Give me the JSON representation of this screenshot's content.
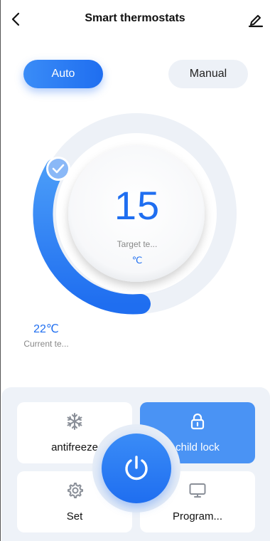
{
  "header": {
    "title": "Smart thermostats",
    "back_icon": "chevron-left-icon",
    "edit_icon": "pencil-icon"
  },
  "modes": {
    "auto_label": "Auto",
    "manual_label": "Manual",
    "selected": "Auto"
  },
  "dial": {
    "target_value": "15",
    "target_label": "Target te...",
    "target_unit": "℃",
    "current_value": "22℃",
    "current_label": "Current te...",
    "accent_color": "#1f6ef0"
  },
  "controls": {
    "antifreeze_label": "antifreeze",
    "child_lock_label": "child lock",
    "set_label": "Set",
    "program_label": "Program...",
    "child_lock_active": true,
    "power_icon": "power-icon"
  }
}
